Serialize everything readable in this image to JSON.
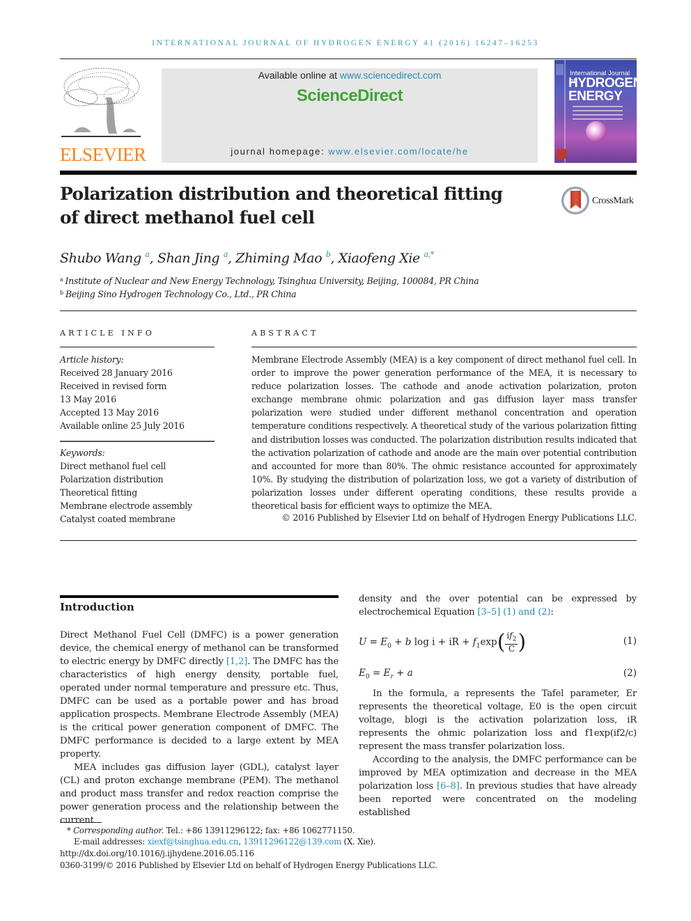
{
  "running_head": "INTERNATIONAL JOURNAL OF HYDROGEN ENERGY 41 (2016) 16247–16253",
  "masthead": {
    "publisher_logo_text": "ELSEVIER",
    "available_prefix": "Available online at ",
    "available_url": "www.sciencedirect.com",
    "platform_name": "ScienceDirect",
    "homepage_prefix": "journal homepage: ",
    "homepage_url": "www.elsevier.com/locate/he",
    "cover": {
      "line1": "International Journal of",
      "line2": "HYDROGEN",
      "line3": "ENERGY"
    },
    "colors": {
      "elsevier_orange": "#f58220",
      "sciencedirect_green": "#3fa535",
      "link_blue": "#2a8bb5"
    }
  },
  "article": {
    "title_line1": "Polarization distribution and theoretical fitting",
    "title_line2": "of direct methanol fuel cell",
    "crossmark_label": "CrossMark",
    "authors": [
      {
        "name": "Shubo Wang",
        "sup": "a"
      },
      {
        "name": "Shan Jing",
        "sup": "a"
      },
      {
        "name": "Zhiming Mao",
        "sup": "b"
      },
      {
        "name": "Xiaofeng Xie",
        "sup": "a,*"
      }
    ],
    "affiliations": [
      {
        "mark": "a",
        "text": "Institute of Nuclear and New Energy Technology, Tsinghua University, Beijing, 100084, PR China"
      },
      {
        "mark": "b",
        "text": "Beijing Sino Hydrogen Technology Co., Ltd., PR China"
      }
    ]
  },
  "article_info": {
    "heading": "ARTICLE INFO",
    "history_label": "Article history:",
    "history": [
      "Received 28 January 2016",
      "Received in revised form",
      "13 May 2016",
      "Accepted 13 May 2016",
      "Available online 25 July 2016"
    ],
    "keywords_label": "Keywords:",
    "keywords": [
      "Direct methanol fuel cell",
      "Polarization distribution",
      "Theoretical fitting",
      "Membrane electrode assembly",
      "Catalyst coated membrane"
    ]
  },
  "abstract": {
    "heading": "ABSTRACT",
    "text": "Membrane Electrode Assembly (MEA) is a key component of direct methanol fuel cell. In order to improve the power generation performance of the MEA, it is necessary to reduce polarization losses. The cathode and anode activation polarization, proton exchange membrane ohmic polarization and gas diffusion layer mass transfer polarization were studied under different methanol concentration and operation temperature conditions respectively. A theoretical study of the various polarization fitting and distribution losses was conducted. The polarization distribution results indicated that the activation polarization of cathode and anode are the main over potential contribution and accounted for more than 80%. The ohmic resistance accounted for approximately 10%. By studying the distribution of polarization loss, we got a variety of distribution of polarization losses under different operating conditions, these results provide a theoretical basis for efficient ways to optimize the MEA.",
    "copyright": "© 2016 Published by Elsevier Ltd on behalf of Hydrogen Energy Publications LLC."
  },
  "intro": {
    "heading": "Introduction",
    "p1_before": "Direct Methanol Fuel Cell (DMFC) is a power generation device, the chemical energy of methanol can be transformed to electric energy by DMFC directly ",
    "p1_ref": "[1,2]",
    "p1_after": ". The DMFC has the characteristics of high energy density, portable fuel, operated under normal temperature and pressure etc. Thus, DMFC can be used as a portable power and has broad application prospects. Membrane Electrode Assembly (MEA) is the critical power generation component of DMFC. The DMFC performance is decided to a large extent by MEA property.",
    "p2": "MEA includes gas diffusion layer (GDL), catalyst layer (CL) and proton exchange membrane (PEM). The methanol and product mass transfer and redox reaction comprise the power generation process and the relationship between the current",
    "r1_before": "density and the over potential can be expressed by electrochemical Equation ",
    "r1_ref1": "[3–5]",
    "r1_ref2": "(1) and (2)",
    "r1_after": ":",
    "eq1_number": "(1)",
    "eq2_number": "(2)",
    "r2": "In the formula, a represents the Tafel parameter, Er represents the theoretical voltage, E0 is the open circuit voltage, blogi is the activation polarization loss, iR represents the ohmic polarization loss and f1exp(if2/c) represent the mass transfer polarization loss.",
    "r3_before": "According to the analysis, the DMFC performance can be improved by MEA optimization and decrease in the MEA polarization loss ",
    "r3_ref": "[6–8]",
    "r3_after": ". In previous studies that have already been reported were concentrated on the modeling established"
  },
  "footnotes": {
    "corr_mark": "*",
    "corr_label": "Corresponding author.",
    "corr_text": " Tel.: +86 13911296122; fax: +86 1062771150.",
    "email_label": "E-mail addresses: ",
    "email1": "xiexf@tsinghua.edu.cn",
    "email_sep": ", ",
    "email2": "13911296122@139.com",
    "email_suffix": " (X. Xie).",
    "doi": "http://dx.doi.org/10.1016/j.ijhydene.2016.05.116",
    "issn_copyright": "0360-3199/© 2016 Published by Elsevier Ltd on behalf of Hydrogen Energy Publications LLC."
  }
}
